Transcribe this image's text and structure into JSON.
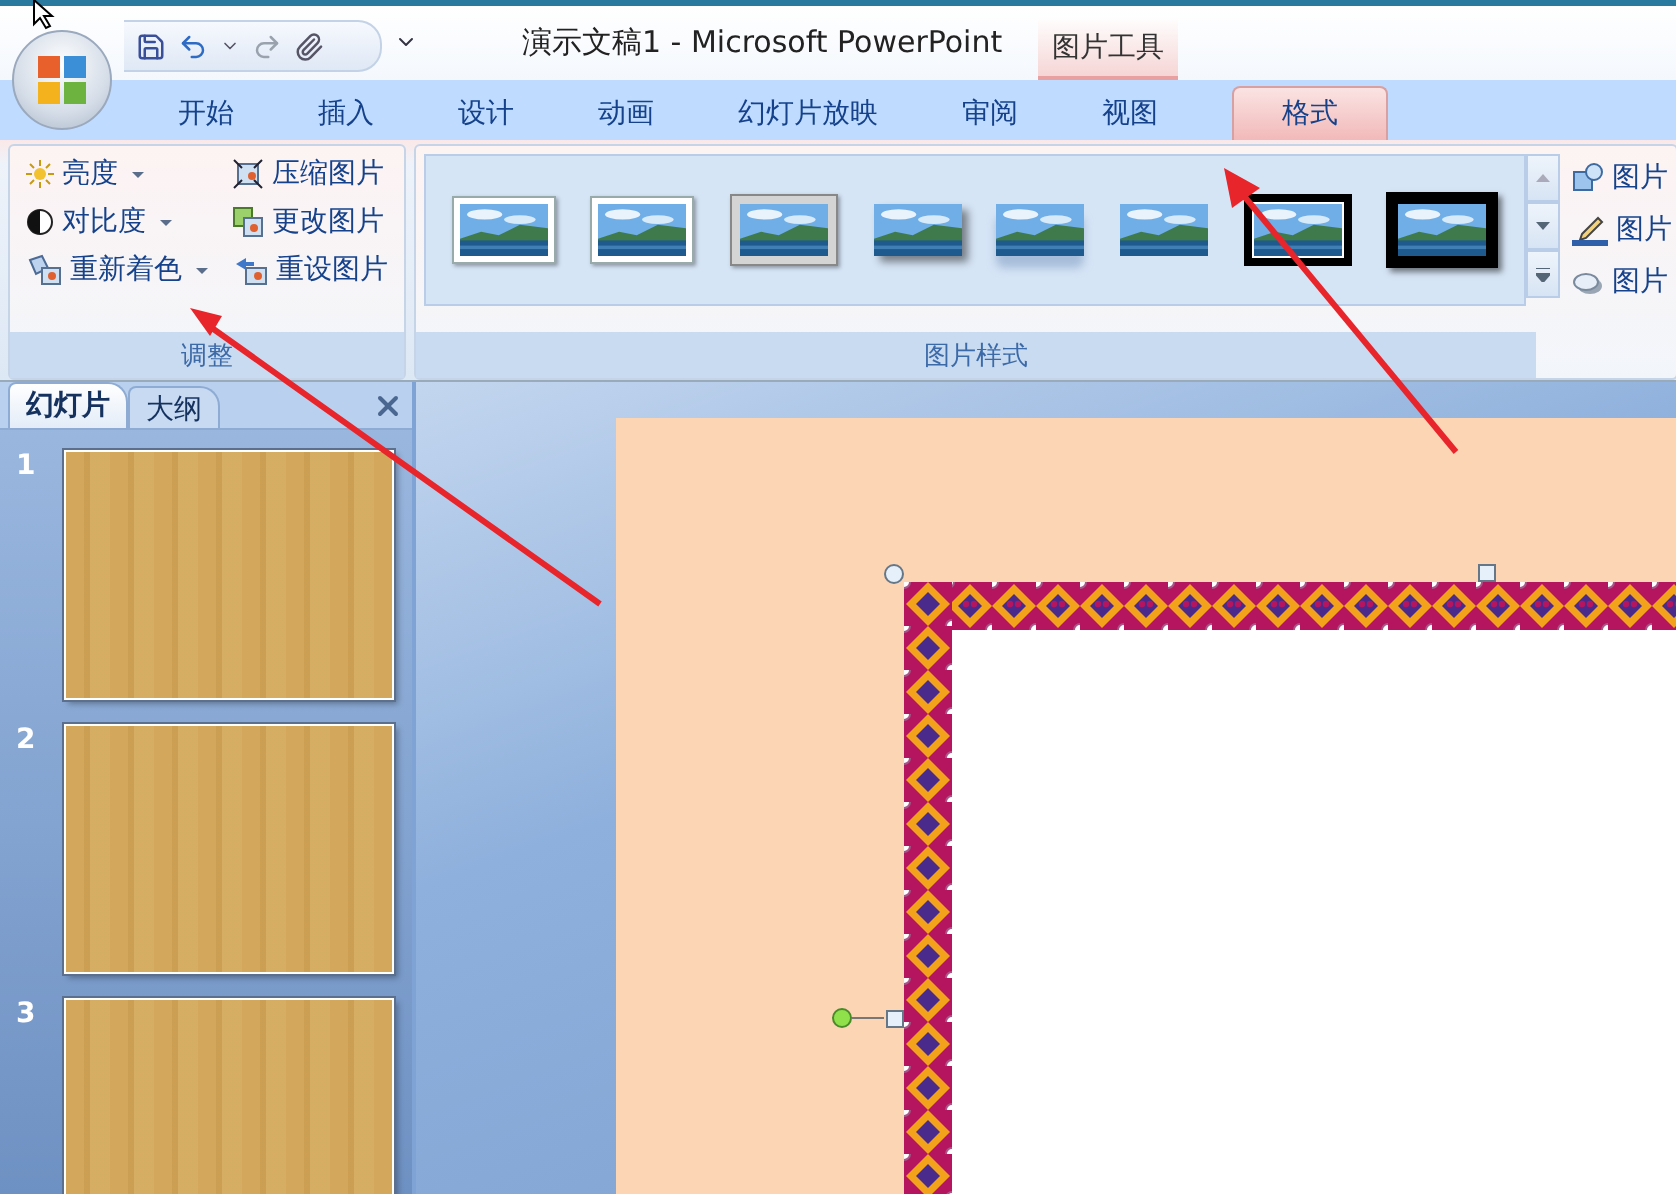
{
  "title_bar": {
    "title": "演示文稿1 - Microsoft PowerPoint",
    "contextual_header": "图片工具"
  },
  "tabs": [
    {
      "label": "开始",
      "selected": false
    },
    {
      "label": "插入",
      "selected": false
    },
    {
      "label": "设计",
      "selected": false
    },
    {
      "label": "动画",
      "selected": false
    },
    {
      "label": "幻灯片放映",
      "selected": false
    },
    {
      "label": "审阅",
      "selected": false
    },
    {
      "label": "视图",
      "selected": false
    },
    {
      "label": "格式",
      "selected": true
    }
  ],
  "adjust_group": {
    "label": "调整",
    "commands": [
      {
        "label": "亮度",
        "dropdown": true
      },
      {
        "label": "压缩图片",
        "dropdown": false
      },
      {
        "label": "对比度",
        "dropdown": true
      },
      {
        "label": "更改图片",
        "dropdown": false
      },
      {
        "label": "重新着色",
        "dropdown": true
      },
      {
        "label": "重设图片",
        "dropdown": false
      }
    ]
  },
  "styles_group": {
    "label": "图片样式",
    "gallery": [
      {
        "kind": "white-frame"
      },
      {
        "kind": "white-frame"
      },
      {
        "kind": "gray-frame"
      },
      {
        "kind": "shadow"
      },
      {
        "kind": "reflection"
      },
      {
        "kind": "soft-edge"
      },
      {
        "kind": "double-black"
      },
      {
        "kind": "thick-black"
      }
    ],
    "side_commands": [
      {
        "label": "图片"
      },
      {
        "label": "图片"
      },
      {
        "label": "图片"
      }
    ]
  },
  "slides_pane": {
    "tabs": [
      {
        "label": "幻灯片",
        "selected": true
      },
      {
        "label": "大纲",
        "selected": false
      }
    ],
    "slides": [
      {
        "number": "1"
      },
      {
        "number": "2"
      },
      {
        "number": "3"
      }
    ]
  }
}
